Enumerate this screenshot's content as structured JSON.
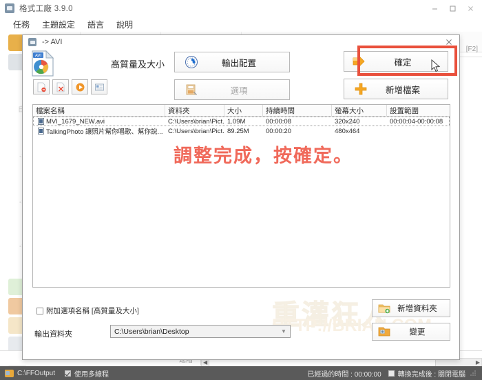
{
  "window": {
    "title": "格式工廠 3.9.0",
    "icon": "app-icon",
    "controls": {
      "minimize": "minimize-icon",
      "maximize": "maximize-icon",
      "close": "close-icon"
    },
    "menu": [
      "任務",
      "主題設定",
      "語言",
      "說明"
    ],
    "f2_hint": "[F2]",
    "progress_label": "進階"
  },
  "dialog": {
    "title": "-> AVI",
    "close_label": "✕",
    "quality_label": "高質量及大小",
    "format_icon": "avi-file-icon",
    "buttons": {
      "output_config": "輸出配置",
      "options": "選項",
      "confirm": "確定",
      "add_file": "新增檔案",
      "new_folder": "新增資料夾",
      "change": "變更"
    },
    "mini_toolbar": [
      "remove-file-icon",
      "clear-list-icon",
      "play-icon",
      "properties-icon"
    ],
    "filelist": {
      "columns": [
        "檔案名稱",
        "資料夾",
        "大小",
        "持續時間",
        "螢幕大小",
        "設置範圍"
      ],
      "rows": [
        {
          "name": "MVI_1679_NEW.avi",
          "folder": "C:\\Users\\brian\\Pict...",
          "size": "1.09M",
          "duration": "00:00:08",
          "screen": "320x240",
          "range": "00:00:04-00:00:08",
          "selected": true
        },
        {
          "name": "TalkingPhoto 讓照片幫你唱歌、幫你說...",
          "folder": "C:\\Users\\brian\\Pict...",
          "size": "89.25M",
          "duration": "00:00:20",
          "screen": "480x464",
          "range": "",
          "selected": false
        }
      ]
    },
    "annotation": "調整完成，按確定。",
    "annotation_color": "#f0695a",
    "append_option": {
      "label": "附加選項名稱 [高質量及大小]",
      "checked": false
    },
    "output_folder": {
      "label": "輸出資料夾",
      "value": "C:\\Users\\brian\\Desktop"
    },
    "highlight_color": "#e9503c"
  },
  "statusbar": {
    "output_path": "C:\\FFOutput",
    "multithread_label": "使用多線程",
    "multithread_checked": true,
    "elapsed_label": "已經過的時間 : 00:00:00",
    "after_convert_label": "轉換完成後 : 關閉電腦",
    "after_convert_checked": false
  },
  "watermark": {
    "zh": "重灌狂人",
    "en": "HTTP://BRIAN.COM"
  }
}
